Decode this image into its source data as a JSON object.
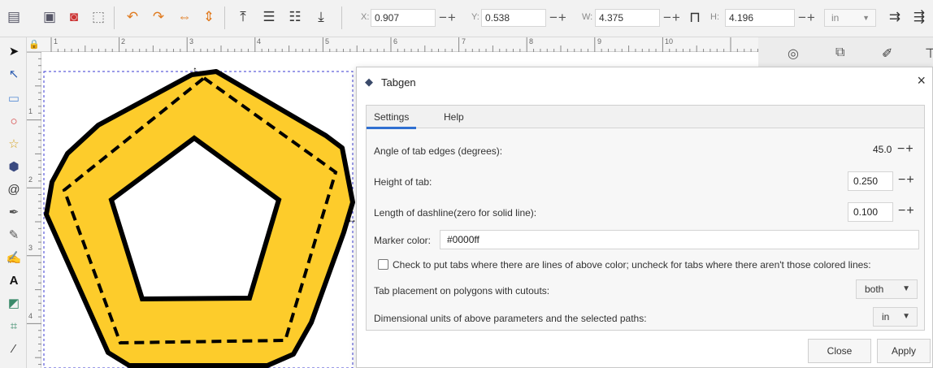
{
  "toolbar": {
    "x_label": "X:",
    "x_value": "0.907",
    "y_label": "Y:",
    "y_value": "0.538",
    "w_label": "W:",
    "w_value": "4.375",
    "h_label": "H:",
    "h_value": "4.196",
    "units": "in",
    "pm": "−+"
  },
  "ruler": {
    "h_numbers": [
      "1",
      "2",
      "3",
      "4",
      "5",
      "6",
      "7",
      "8",
      "9",
      "10"
    ],
    "v_numbers": [
      "1",
      "2",
      "3",
      "4"
    ]
  },
  "dialog": {
    "title": "Tabgen",
    "close_glyph": "×",
    "tabs": [
      {
        "label": "Settings"
      },
      {
        "label": "Help"
      }
    ],
    "angle_label": "Angle of tab edges (degrees):",
    "angle_value": "45.0",
    "height_label": "Height of tab:",
    "height_value": "0.250",
    "dash_label": "Length of dashline(zero for solid line):",
    "dash_value": "0.100",
    "marker_label": "Marker color:",
    "marker_value": "#0000ff",
    "checkbox_label": "Check to put tabs where there are lines of above color; uncheck for tabs where there aren't those colored lines:",
    "placement_label": "Tab placement on polygons with cutouts:",
    "placement_value": "both",
    "units_label": "Dimensional units of above parameters and the selected paths:",
    "units_value": "in",
    "close_button": "Close",
    "apply_button": "Apply",
    "pm": "−+"
  },
  "colors": {
    "shape_fill": "#fdcc2b",
    "accent": "#2f6fd1",
    "selection": "#3a3ad0"
  }
}
